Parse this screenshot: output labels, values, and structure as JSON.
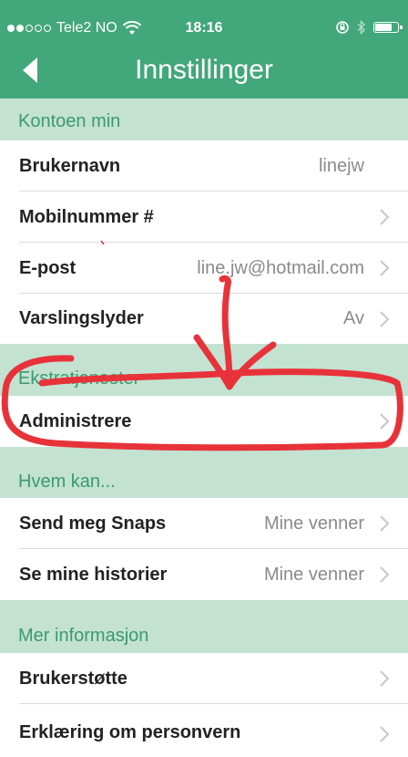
{
  "status_bar": {
    "carrier": "Tele2 NO",
    "time": "18:16",
    "signal_bars_filled": 2,
    "signal_bars_total": 5,
    "battery_level": 0.75
  },
  "nav": {
    "title": "Innstillinger",
    "back_icon": "chevron-left-icon"
  },
  "sections": {
    "account": {
      "header": "Kontoen min",
      "username": {
        "label": "Brukernavn",
        "value": "linejw"
      },
      "mobile": {
        "label": "Mobilnummer #"
      },
      "email": {
        "label": "E-post",
        "value": "line.jw@hotmail.com"
      },
      "notification_sounds": {
        "label": "Varslingslyder",
        "value": "Av"
      }
    },
    "extra_services": {
      "header": "Ekstratjenester",
      "manage": {
        "label": "Administrere"
      }
    },
    "who_can": {
      "header": "Hvem kan...",
      "send_snaps": {
        "label": "Send meg Snaps",
        "value": "Mine venner"
      },
      "view_stories": {
        "label": "Se mine historier",
        "value": "Mine venner"
      }
    },
    "more_info": {
      "header": "Mer informasjon",
      "support": {
        "label": "Brukerstøtte"
      },
      "privacy": {
        "label": "Erklæring om personvern"
      }
    }
  },
  "colors": {
    "brand_green": "#42a77a",
    "section_bg": "#c3e2d2",
    "section_text": "#3c9a6c",
    "annotation_red": "#e8323a"
  }
}
